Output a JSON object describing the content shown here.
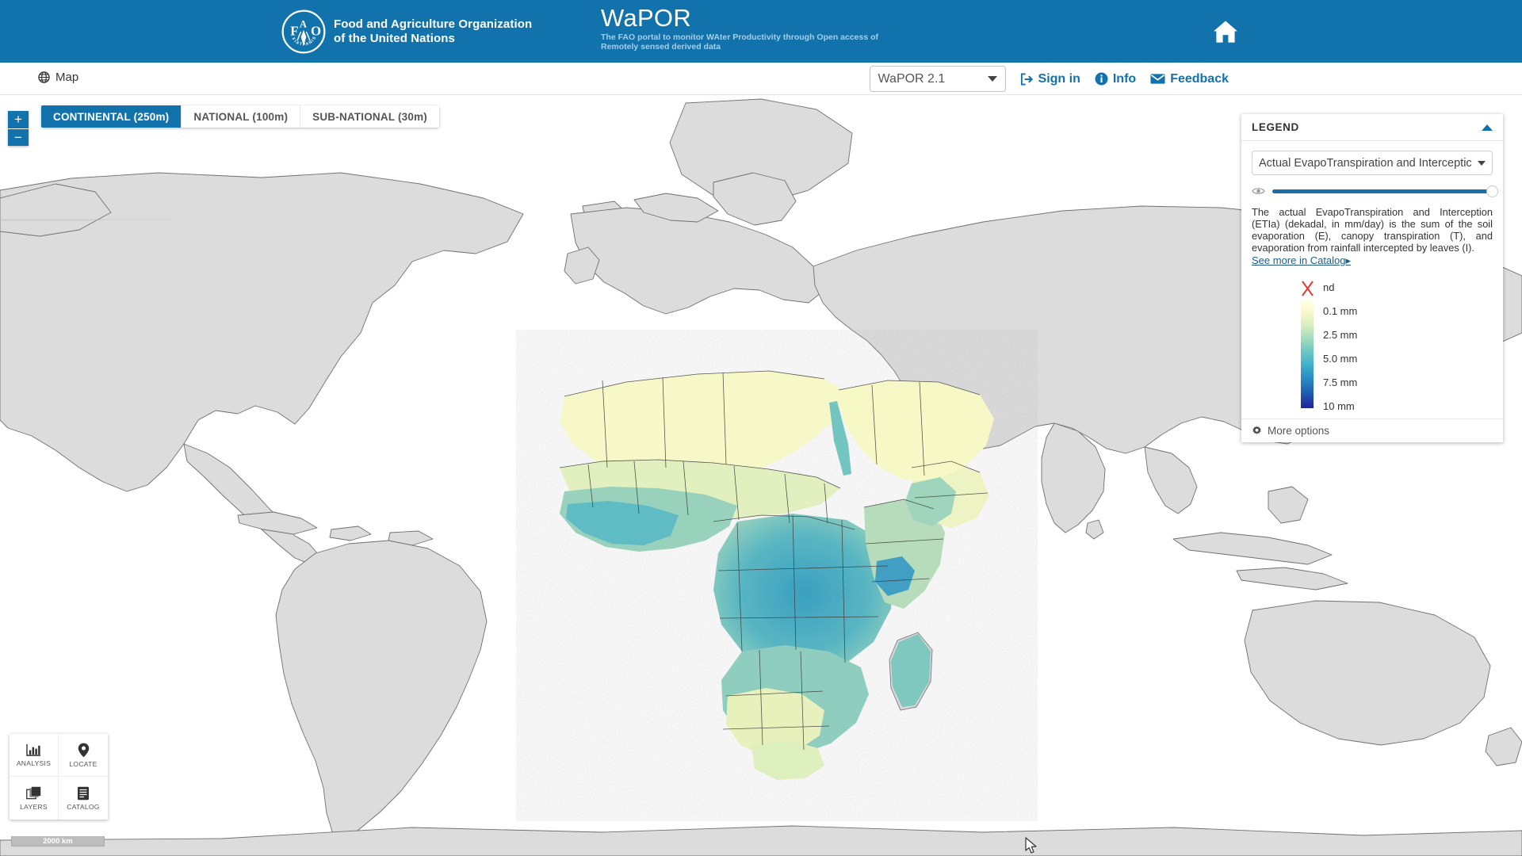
{
  "header": {
    "fao_name": "Food and Agriculture Organization\nof the United Nations",
    "logo_icon": "fao-logo-icon",
    "app_title": "WaPOR",
    "app_subtitle": "The FAO portal to monitor WAter Productivity through Open access of Remotely sensed derived data",
    "home_icon": "home-icon",
    "background_color": "#1272ab"
  },
  "toolbar": {
    "map_label": "Map",
    "map_icon": "globe-icon",
    "version": {
      "selected": "WaPOR 2.1",
      "caret_icon": "chevron-down-icon"
    },
    "links": [
      {
        "label": "Sign in",
        "icon": "sign-in-icon"
      },
      {
        "label": "Info",
        "icon": "info-circle-icon"
      },
      {
        "label": "Feedback",
        "icon": "envelope-icon"
      }
    ],
    "link_color": "#1272ab"
  },
  "map": {
    "zoom_in_label": "+",
    "zoom_out_label": "−",
    "scale_tabs": [
      {
        "label": "CONTINENTAL (250m)",
        "active": true
      },
      {
        "label": "NATIONAL (100m)",
        "active": false
      },
      {
        "label": "SUB-NATIONAL (30m)",
        "active": false
      }
    ],
    "scalebar_label": "2000 km",
    "land_color": "#dcdcdc",
    "ocean_color": "#ffffff",
    "border_color": "#6f6f6f",
    "active_tab_color": "#1272ab"
  },
  "legend": {
    "title": "LEGEND",
    "collapse_icon": "chevron-up-icon",
    "layer_selected": "Actual EvapoTranspiration and Interceptic",
    "layer_caret_icon": "chevron-down-icon",
    "visibility_icon": "eye-icon",
    "opacity_value": 100,
    "description": "The actual EvapoTranspiration and Interception (ETIa) (dekadal, in mm/day) is the sum of the soil evaporation (E), canopy transpiration (T), and evaporation from rainfall intercepted by leaves (I).",
    "catalog_link": "See more in Catalog▸",
    "ramp": {
      "nd_icon": "red-x-icon",
      "stops": [
        {
          "label": "nd",
          "color": "#ffffff"
        },
        {
          "label": "0.1 mm",
          "color": "#f7f8c8"
        },
        {
          "label": "2.5 mm",
          "color": "#a9ddbb"
        },
        {
          "label": "5.0 mm",
          "color": "#45b2cc"
        },
        {
          "label": "7.5 mm",
          "color": "#1f63b4"
        },
        {
          "label": "10 mm",
          "color": "#21219a"
        }
      ]
    },
    "more_options": "More options",
    "more_options_icon": "gear-icon"
  },
  "tools": [
    {
      "label": "ANALYSIS",
      "icon": "bar-chart-icon"
    },
    {
      "label": "LOCATE",
      "icon": "map-pin-icon"
    },
    {
      "label": "LAYERS",
      "icon": "layers-icon"
    },
    {
      "label": "CATALOG",
      "icon": "book-icon"
    }
  ]
}
